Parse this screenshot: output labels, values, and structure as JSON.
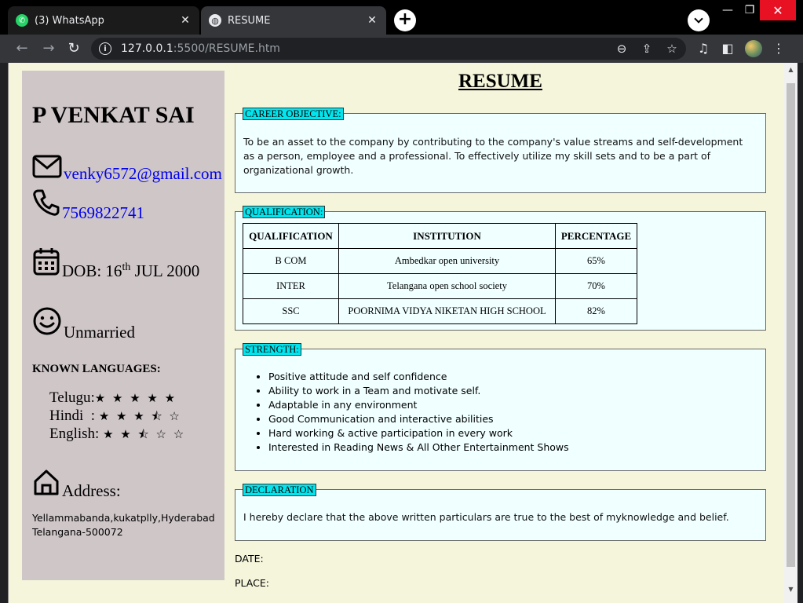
{
  "browser": {
    "tabs": [
      {
        "title": "(3) WhatsApp",
        "favicon": "whatsapp-icon"
      },
      {
        "title": "RESUME",
        "favicon": "globe-icon"
      }
    ],
    "url_host": "127.0.0.1",
    "url_path": ":5500/RESUME.htm"
  },
  "resume": {
    "heading": "RESUME",
    "name": "P VENKAT SAI",
    "email": "venky6572@gmail.com",
    "phone": "7569822741",
    "dob_prefix": "DOB: 16",
    "dob_sup": "th",
    "dob_suffix": " JUL 2000",
    "marital_status": "Unmarried",
    "languages_heading": "KNOWN LANGUAGES:",
    "languages": [
      {
        "label": "Telugu:",
        "stars": "★ ★ ★ ★ ★"
      },
      {
        "label": "Hindi  :",
        "stars": "★ ★ ★ ⯪ ☆"
      },
      {
        "label": "English:",
        "stars": "★ ★ ⯪ ☆ ☆"
      }
    ],
    "address_label": "Address:",
    "address_line1": "Yellammabanda,kukatplly,Hyderabad",
    "address_line2": "Telangana-500072",
    "career_objective": {
      "legend": "CAREER OBJECTIVE:",
      "text": "To be an asset to the company by contributing to the company's value streams and self-development as a person, employee and a professional. To effectively utilize my skill sets and to be a part of organizational growth."
    },
    "qualification": {
      "legend": "QUALIFICATION:",
      "headers": [
        "QUALIFICATION",
        "INSTITUTION",
        "PERCENTAGE"
      ],
      "rows": [
        [
          "B COM",
          "Ambedkar open university",
          "65%"
        ],
        [
          "INTER",
          "Telangana open school society",
          "70%"
        ],
        [
          "SSC",
          "POORNIMA VIDYA NIKETAN HIGH SCHOOL",
          "82%"
        ]
      ]
    },
    "strength": {
      "legend": "STRENGTH:",
      "items": [
        "Positive attitude and self confidence",
        "Ability to work in a Team and motivate self.",
        "Adaptable in any environment",
        "Good Communication and interactive abilities",
        "Hard working & active participation in every work",
        "Interested in Reading News & All Other Entertainment Shows"
      ]
    },
    "declaration": {
      "legend": "DECLARATION",
      "text": "I hereby declare that the above written particulars are true to the best of myknowledge and belief."
    },
    "date_label": "DATE:",
    "place_label": "PLACE:"
  }
}
